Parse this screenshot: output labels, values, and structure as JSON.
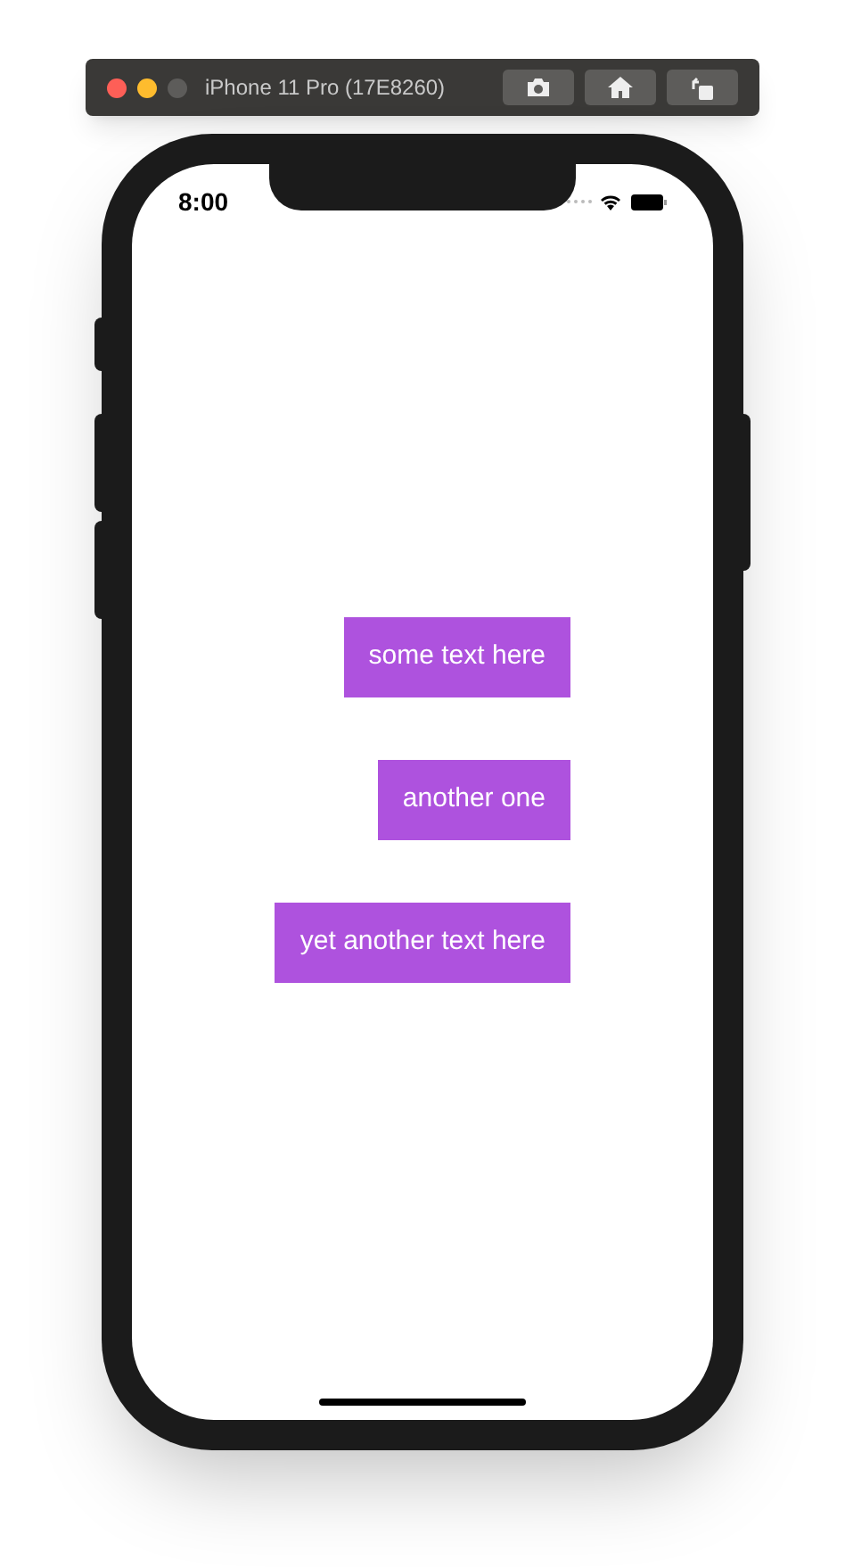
{
  "simulator_window": {
    "title": "iPhone 11 Pro (17E8260)"
  },
  "status_bar": {
    "time": "8:00"
  },
  "labels": [
    "some text here",
    "another one",
    "yet another text here"
  ]
}
